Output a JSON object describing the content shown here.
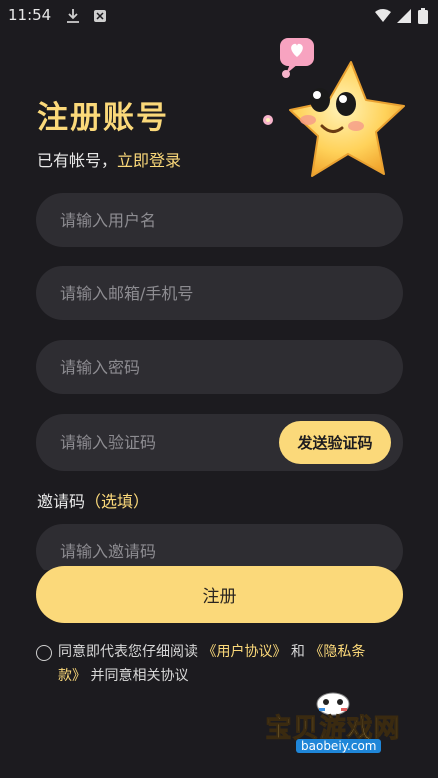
{
  "status_bar": {
    "time": "11:54"
  },
  "header": {
    "title": "注册账号",
    "has_account_text": "已有帐号，",
    "login_link": "立即登录"
  },
  "fields": {
    "username_placeholder": "请输入用户名",
    "email_phone_placeholder": "请输入邮箱/手机号",
    "password_placeholder": "请输入密码",
    "code_placeholder": "请输入验证码",
    "invite_placeholder": "请输入邀请码"
  },
  "send_code_label": "发送验证码",
  "invite": {
    "label": "邀请码",
    "optional": "（选填）"
  },
  "register_label": "注册",
  "agreement": {
    "prefix": "同意即代表您仔细阅读 ",
    "user_agreement": "《用户协议》",
    "and": " 和 ",
    "privacy_policy": "《隐私条款》",
    "suffix": " 并同意相关协议"
  },
  "watermark": {
    "name": "宝贝游戏网",
    "url": "baobeiy.com"
  },
  "colors": {
    "accent": "#fbd97a",
    "background": "#1c1b1f",
    "field": "#2e2d32"
  }
}
